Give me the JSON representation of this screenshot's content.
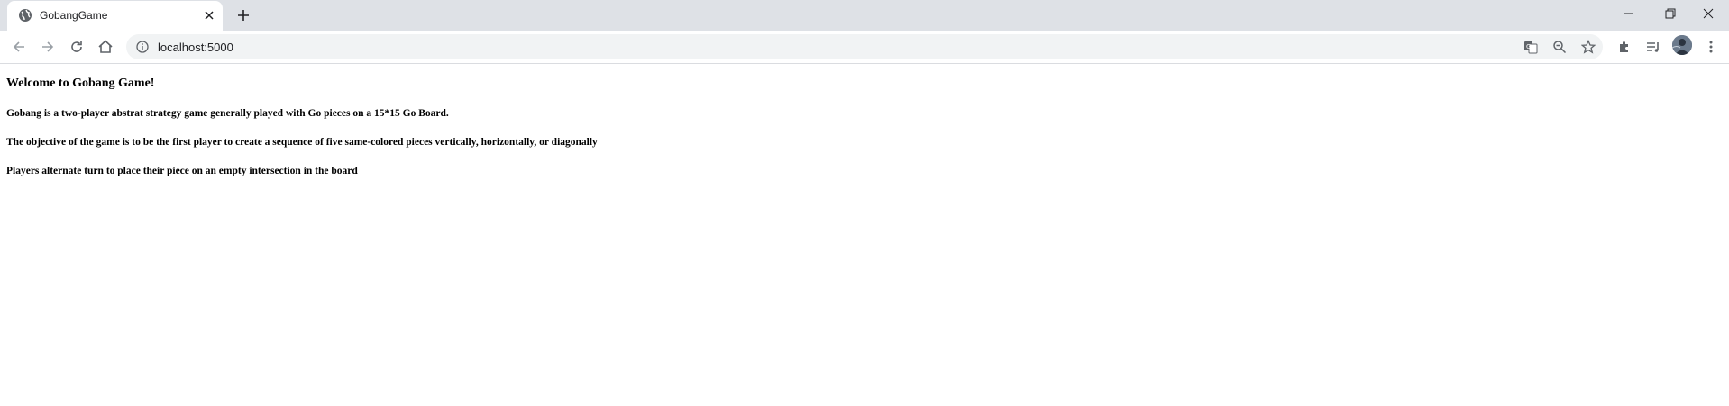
{
  "browser": {
    "tab": {
      "title": "GobangGame",
      "favicon": "globe-icon"
    },
    "omnibox": {
      "url": "localhost:5000",
      "info_icon": "info-icon"
    },
    "toolbar_icons": [
      "back-icon",
      "forward-icon",
      "reload-icon",
      "home-icon",
      "translate-icon",
      "zoom-icon",
      "bookmark-star-icon",
      "extensions-icon",
      "reading-list-icon",
      "menu-icon"
    ]
  },
  "page": {
    "heading": "Welcome to Gobang Game!",
    "paragraphs": [
      "Gobang is a two-player abstrat strategy game generally played with Go pieces on a 15*15 Go Board.",
      "The objective of the game is to be the first player to create a sequence of five same-colored pieces vertically, horizontally, or diagonally",
      "Players alternate turn to place their piece on an empty intersection in the board"
    ]
  }
}
